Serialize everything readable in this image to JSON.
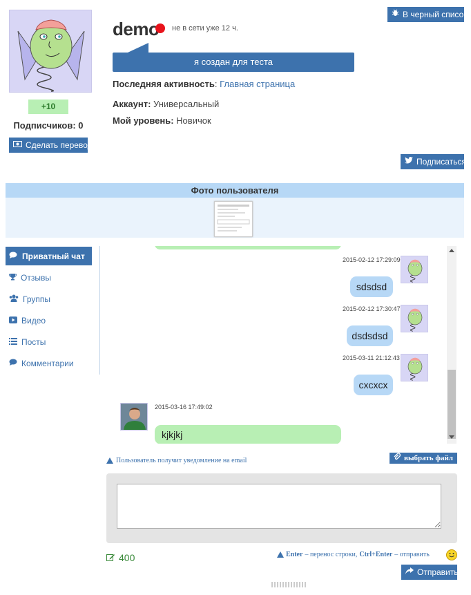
{
  "profile": {
    "username": "demo",
    "online_status": "не в сети уже 12 ч.",
    "status_message": "я создан для теста",
    "rating": "+10",
    "subscribers_label": "Подписчиков: 0",
    "transfer_button": "Сделать перевод",
    "blacklist_button": "В черный список",
    "subscribe_button": "Подписаться",
    "status_color": "#e8131b",
    "accent_color": "#3d72ad"
  },
  "info": {
    "activity_label": "Последняя активность",
    "activity_value": "Главная страница",
    "account_label": "Аккаунт:",
    "account_value": "Универсальный",
    "level_label": "Мой уровень:",
    "level_value": "Новичок"
  },
  "photos": {
    "title": "Фото пользователя"
  },
  "menu": {
    "items": [
      {
        "label": "Приватный чат",
        "icon": "comments-icon",
        "active": true
      },
      {
        "label": "Отзывы",
        "icon": "trophy-icon"
      },
      {
        "label": "Группы",
        "icon": "users-icon"
      },
      {
        "label": "Видео",
        "icon": "video-icon"
      },
      {
        "label": "Посты",
        "icon": "list-icon"
      },
      {
        "label": "Комментарии",
        "icon": "comment-icon"
      }
    ]
  },
  "chat": {
    "messages": [
      {
        "time": "2015-02-12 17:29:09",
        "text": "sdsdsd",
        "side": "right"
      },
      {
        "time": "2015-02-12 17:30:47",
        "text": "dsdsdsd",
        "side": "right"
      },
      {
        "time": "2015-03-11 21:12:43",
        "text": "cxcxcx",
        "side": "right"
      },
      {
        "time": "2015-03-16 17:49:02",
        "text": "kjkjkj",
        "side": "left"
      }
    ]
  },
  "composer": {
    "email_notice": "Пользователь получит уведомление на email",
    "file_button": "выбрать файл",
    "char_count": "400",
    "hint_enter": "Enter",
    "hint_enter_text": " – перенос строки, ",
    "hint_ctrl": "Ctrl+Enter",
    "hint_ctrl_text": " – отправить",
    "send_button": "Отправить"
  }
}
